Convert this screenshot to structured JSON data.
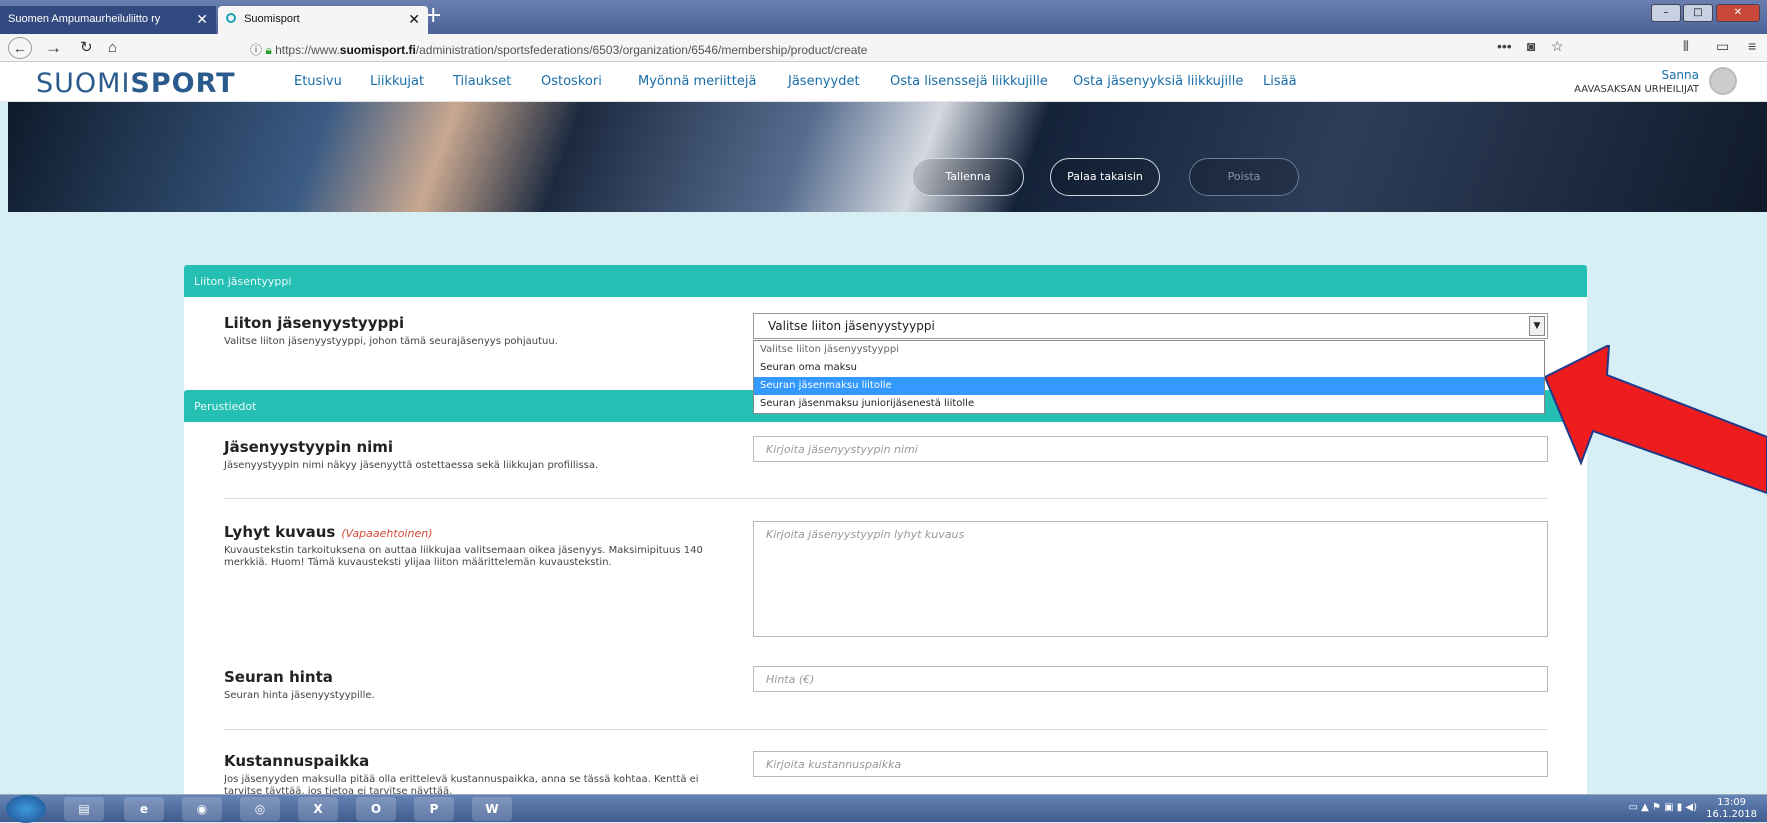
{
  "browser": {
    "tabs": [
      {
        "title": "Suomen Ampumaurheiluliitto ry",
        "active": false
      },
      {
        "title": "Suomisport",
        "active": true
      }
    ],
    "url_prefix": "https://www.",
    "url_domain": "suomisport.fi",
    "url_path": "/administration/sportsfederations/6503/organization/6546/membership/product/create",
    "menu_dots": "•••"
  },
  "site": {
    "logo_light": "SUOMI",
    "logo_bold": "SPORT",
    "nav": [
      "Etusivu",
      "Liikkujat",
      "Tilaukset",
      "Ostoskori",
      "Myönnä meriittejä",
      "Jäsenyydet",
      "Osta lisenssejä liikkujille",
      "Osta jäsenyyksiä liikkujille",
      "Lisää"
    ],
    "user_name": "Sanna",
    "user_org": "AAVASAKSAN URHEILIJAT"
  },
  "hero": {
    "save": "Tallenna",
    "back": "Palaa takaisin",
    "delete": "Poista"
  },
  "sections": {
    "federation_type": {
      "header": "Liiton jäsentyyppi",
      "title": "Liiton jäsenyystyyppi",
      "desc": "Valitse liiton jäsenyystyyppi, johon tämä seurajäsenyys pohjautuu.",
      "select_value": "Valitse liiton jäsenyystyyppi",
      "options": [
        "Valitse liiton jäsenyystyyppi",
        "Seuran oma maksu",
        "Seuran jäsenmaksu liitolle",
        "Seuran jäsenmaksu juniorijäsenestä liitolle"
      ],
      "selected_index": 2
    },
    "basic": {
      "header": "Perustiedot",
      "name_title": "Jäsenyystyypin nimi",
      "name_desc": "Jäsenyystyypin nimi näkyy jäsenyyttä ostettaessa sekä liikkujan profiilissa.",
      "name_placeholder": "Kirjoita jäsenyystyypin nimi",
      "short_title": "Lyhyt kuvaus",
      "short_optional": "(Vapaaehtoinen)",
      "short_desc": "Kuvaustekstin tarkoituksena on auttaa liikkujaa valitsemaan oikea jäsenyys. Maksimipituus 140 merkkiä. Huom! Tämä kuvausteksti ylijaa liiton määrittelemän kuvaustekstin.",
      "short_placeholder": "Kirjoita jäsenyystyypin lyhyt kuvaus",
      "price_title": "Seuran hinta",
      "price_desc": "Seuran hinta jäsenyystyypille.",
      "price_placeholder": "Hinta (€)",
      "cost_title": "Kustannuspaikka",
      "cost_desc": "Jos jäsenyyden maksulla pitää olla erittelevä kustannuspaikka, anna se tässä kohtaa. Kenttä ei tarvitse täyttää, jos tietoa ei tarvitse näyttää.",
      "cost_placeholder": "Kirjoita kustannuspaikka"
    }
  },
  "taskbar": {
    "time": "13:09",
    "date": "16.1.2018"
  },
  "colors": {
    "teal_header": "#26bfb4",
    "link_blue": "#1a6ea8",
    "arrow_red": "#ee1c1c",
    "page_bg": "#d8eef5"
  }
}
